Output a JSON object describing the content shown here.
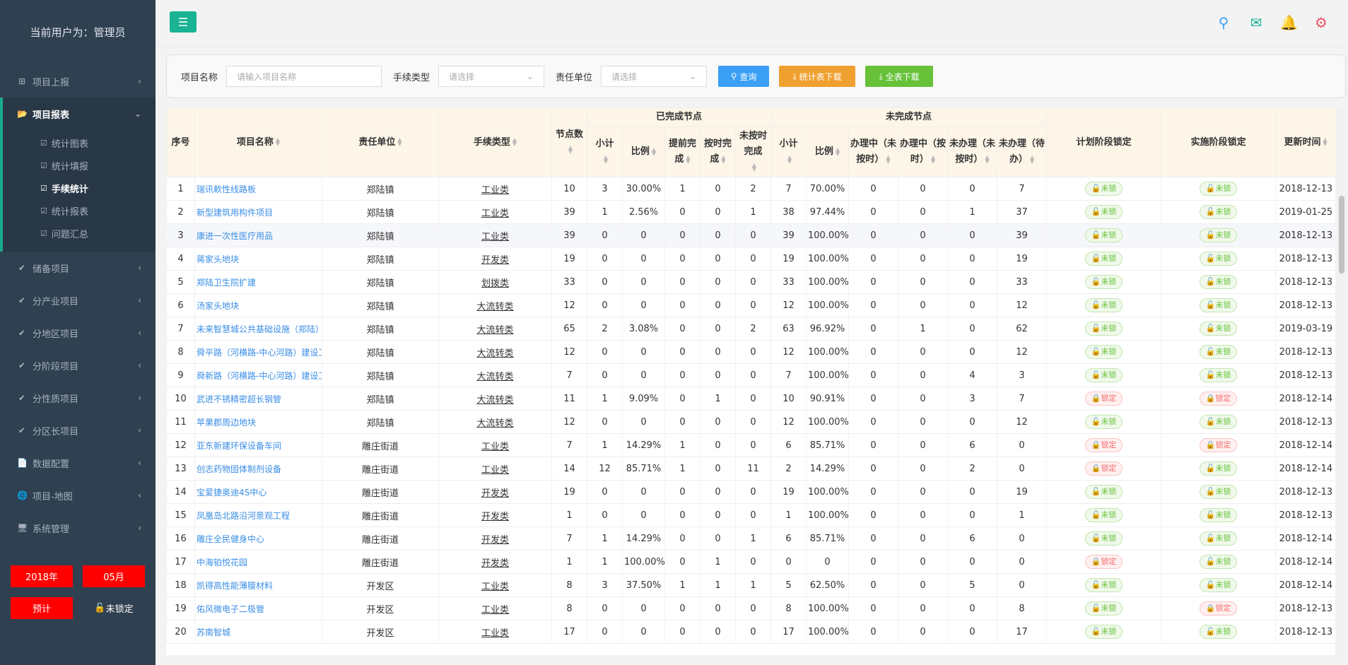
{
  "sidebar": {
    "user": "当前用户为：管理员",
    "items": [
      {
        "label": "项目上报",
        "icon": "plus-square-icon"
      },
      {
        "label": "项目报表",
        "icon": "folder-open-icon"
      },
      {
        "label": "储备项目",
        "icon": "check-icon"
      },
      {
        "label": "分产业项目",
        "icon": "check-icon"
      },
      {
        "label": "分地区项目",
        "icon": "check-icon"
      },
      {
        "label": "分阶段项目",
        "icon": "check-icon"
      },
      {
        "label": "分性质项目",
        "icon": "check-icon"
      },
      {
        "label": "分区长项目",
        "icon": "check-icon"
      },
      {
        "label": "数据配置",
        "icon": "file-icon"
      },
      {
        "label": "项目-地图",
        "icon": "globe-icon"
      },
      {
        "label": "系统管理",
        "icon": "desktop-icon"
      }
    ],
    "subitems": [
      "统计图表",
      "统计填报",
      "手续统计",
      "统计报表",
      "问题汇总"
    ],
    "year": "2018年",
    "month": "05月",
    "warn": "预计",
    "lock": "未锁定"
  },
  "search": {
    "name_label": "项目名称",
    "name_placeholder": "请输入项目名称",
    "type_label": "手续类型",
    "type_placeholder": "请选择",
    "unit_label": "责任单位",
    "unit_placeholder": "请选择",
    "query": "查询",
    "stat_download": "统计表下载",
    "all_download": "全表下载"
  },
  "table": {
    "headers": {
      "idx": "序号",
      "name": "项目名称",
      "unit": "责任单位",
      "type": "手续类型",
      "nodes": "节点数",
      "done_group": "已完成节点",
      "undone_group": "未完成节点",
      "subtotal": "小计",
      "ratio": "比例",
      "early": "提前完成",
      "ontime": "按时完成",
      "late": "未按时完成",
      "u_subtotal": "小计",
      "u_ratio": "比例",
      "doing_late": "办理中（未按时）",
      "doing_ontime": "办理中（按时）",
      "todo_late": "未办理（未按时）",
      "todo_wait": "未办理（待办）",
      "plan_lock": "计划阶段锁定",
      "impl_lock": "实施阶段锁定",
      "updated": "更新时间"
    },
    "rows": [
      [
        "1",
        "瑞讯軟性线路板",
        "郑陆镇",
        "工业类",
        "10",
        "3",
        "30.00%",
        "1",
        "0",
        "2",
        "7",
        "70.00%",
        "0",
        "0",
        "0",
        "7",
        "未锁",
        "未锁",
        "2018-12-13"
      ],
      [
        "2",
        "新型建筑用构件项目",
        "郑陆镇",
        "工业类",
        "39",
        "1",
        "2.56%",
        "0",
        "0",
        "1",
        "38",
        "97.44%",
        "0",
        "0",
        "1",
        "37",
        "未锁",
        "未锁",
        "2019-01-25"
      ],
      [
        "3",
        "康进一次性医疗用品",
        "郑陆镇",
        "工业类",
        "39",
        "0",
        "0",
        "0",
        "0",
        "0",
        "39",
        "100.00%",
        "0",
        "0",
        "0",
        "39",
        "未锁",
        "未锁",
        "2018-12-13"
      ],
      [
        "4",
        "蒋家头地块",
        "郑陆镇",
        "开发类",
        "19",
        "0",
        "0",
        "0",
        "0",
        "0",
        "19",
        "100.00%",
        "0",
        "0",
        "0",
        "19",
        "未锁",
        "未锁",
        "2018-12-13"
      ],
      [
        "5",
        "郑陆卫生院扩建",
        "郑陆镇",
        "划拨类",
        "33",
        "0",
        "0",
        "0",
        "0",
        "0",
        "33",
        "100.00%",
        "0",
        "0",
        "0",
        "33",
        "未锁",
        "未锁",
        "2018-12-13"
      ],
      [
        "6",
        "汤家头地块",
        "郑陆镇",
        "大流转类",
        "12",
        "0",
        "0",
        "0",
        "0",
        "0",
        "12",
        "100.00%",
        "0",
        "0",
        "0",
        "12",
        "未锁",
        "未锁",
        "2018-12-13"
      ],
      [
        "7",
        "未来智慧城公共基础设施（郑陆）",
        "郑陆镇",
        "大流转类",
        "65",
        "2",
        "3.08%",
        "0",
        "0",
        "2",
        "63",
        "96.92%",
        "0",
        "1",
        "0",
        "62",
        "未锁",
        "未锁",
        "2019-03-19"
      ],
      [
        "8",
        "舜平路（河横路-中心河路）建设工",
        "郑陆镇",
        "大流转类",
        "12",
        "0",
        "0",
        "0",
        "0",
        "0",
        "12",
        "100.00%",
        "0",
        "0",
        "0",
        "12",
        "未锁",
        "未锁",
        "2018-12-13"
      ],
      [
        "9",
        "舜新路（河横路-中心河路）建设工",
        "郑陆镇",
        "大流转类",
        "7",
        "0",
        "0",
        "0",
        "0",
        "0",
        "7",
        "100.00%",
        "0",
        "0",
        "4",
        "3",
        "未锁",
        "未锁",
        "2018-12-13"
      ],
      [
        "10",
        "武进不锈精密超长钢管",
        "郑陆镇",
        "大流转类",
        "11",
        "1",
        "9.09%",
        "0",
        "1",
        "0",
        "10",
        "90.91%",
        "0",
        "0",
        "3",
        "7",
        "锁定",
        "锁定",
        "2018-12-14"
      ],
      [
        "11",
        "苹果郡周边地块",
        "郑陆镇",
        "大流转类",
        "12",
        "0",
        "0",
        "0",
        "0",
        "0",
        "12",
        "100.00%",
        "0",
        "0",
        "0",
        "12",
        "未锁",
        "未锁",
        "2018-12-13"
      ],
      [
        "12",
        "亚东新建环保设备车间",
        "雕庄街道",
        "工业类",
        "7",
        "1",
        "14.29%",
        "1",
        "0",
        "0",
        "6",
        "85.71%",
        "0",
        "0",
        "6",
        "0",
        "锁定",
        "锁定",
        "2018-12-14"
      ],
      [
        "13",
        "创志药物固体制剂设备",
        "雕庄街道",
        "工业类",
        "14",
        "12",
        "85.71%",
        "1",
        "0",
        "11",
        "2",
        "14.29%",
        "0",
        "0",
        "2",
        "0",
        "锁定",
        "未锁",
        "2018-12-14"
      ],
      [
        "14",
        "宝爱捷奥迪4S中心",
        "雕庄街道",
        "开发类",
        "19",
        "0",
        "0",
        "0",
        "0",
        "0",
        "19",
        "100.00%",
        "0",
        "0",
        "0",
        "19",
        "未锁",
        "未锁",
        "2018-12-13"
      ],
      [
        "15",
        "凤凰岛北路沿河景观工程",
        "雕庄街道",
        "开发类",
        "1",
        "0",
        "0",
        "0",
        "0",
        "0",
        "1",
        "100.00%",
        "0",
        "0",
        "0",
        "1",
        "未锁",
        "未锁",
        "2018-12-13"
      ],
      [
        "16",
        "雕庄全民健身中心",
        "雕庄街道",
        "开发类",
        "7",
        "1",
        "14.29%",
        "0",
        "0",
        "1",
        "6",
        "85.71%",
        "0",
        "0",
        "6",
        "0",
        "未锁",
        "未锁",
        "2018-12-14"
      ],
      [
        "17",
        "中海铂悦花园",
        "雕庄街道",
        "开发类",
        "1",
        "1",
        "100.00%",
        "0",
        "1",
        "0",
        "0",
        "0",
        "0",
        "0",
        "0",
        "0",
        "锁定",
        "未锁",
        "2018-12-14"
      ],
      [
        "18",
        "凯得高性能薄膜材料",
        "开发区",
        "工业类",
        "8",
        "3",
        "37.50%",
        "1",
        "1",
        "1",
        "5",
        "62.50%",
        "0",
        "0",
        "5",
        "0",
        "未锁",
        "未锁",
        "2018-12-14"
      ],
      [
        "19",
        "佑风微电子二极管",
        "开发区",
        "工业类",
        "8",
        "0",
        "0",
        "0",
        "0",
        "0",
        "8",
        "100.00%",
        "0",
        "0",
        "0",
        "8",
        "未锁",
        "锁定",
        "2018-12-13"
      ],
      [
        "20",
        "苏南智城",
        "开发区",
        "工业类",
        "17",
        "0",
        "0",
        "0",
        "0",
        "0",
        "17",
        "100.00%",
        "0",
        "0",
        "0",
        "17",
        "未锁",
        "未锁",
        "2018-12-13"
      ]
    ]
  },
  "colors": {
    "accent": "#1ab394",
    "sidebar": "#2f4050",
    "link": "#3a8ee6",
    "unlock": "#67c23a",
    "lock": "#f56c6c"
  }
}
